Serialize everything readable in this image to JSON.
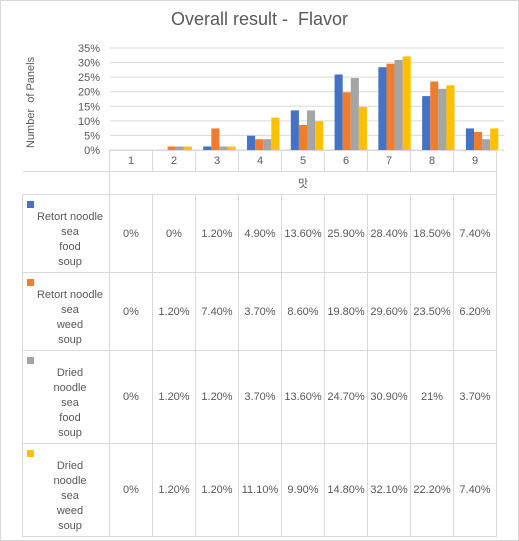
{
  "chart_data": {
    "type": "bar",
    "title": "Overall result -  Flavor",
    "ylabel": "Number  of Panels",
    "xlabel": "맛",
    "categories": [
      "1",
      "2",
      "3",
      "4",
      "5",
      "6",
      "7",
      "8",
      "9"
    ],
    "ylim": [
      0,
      35
    ],
    "yticks": [
      "0%",
      "5%",
      "10%",
      "15%",
      "20%",
      "25%",
      "30%",
      "35%"
    ],
    "ytick_values": [
      0,
      5,
      10,
      15,
      20,
      25,
      30,
      35
    ],
    "grid": true,
    "legend": "data-table",
    "series": [
      {
        "name": "Retort noodle\nsea\nfood\nsoup",
        "color": "#4472c4",
        "values": [
          0,
          0,
          1.2,
          4.9,
          13.6,
          25.9,
          28.4,
          18.5,
          7.4
        ],
        "labels": [
          "0%",
          "0%",
          "1.20%",
          "4.90%",
          "13.60%",
          "25.90%",
          "28.40%",
          "18.50%",
          "7.40%"
        ]
      },
      {
        "name": "Retort noodle\nsea\nweed\nsoup",
        "color": "#ed7d31",
        "values": [
          0,
          1.2,
          7.4,
          3.7,
          8.6,
          19.8,
          29.6,
          23.5,
          6.2
        ],
        "labels": [
          "0%",
          "1.20%",
          "7.40%",
          "3.70%",
          "8.60%",
          "19.80%",
          "29.60%",
          "23.50%",
          "6.20%"
        ]
      },
      {
        "name": "Dried\nnoodle\nsea\nfood\nsoup",
        "color": "#a5a5a5",
        "values": [
          0,
          1.2,
          1.2,
          3.7,
          13.6,
          24.7,
          30.9,
          21,
          3.7
        ],
        "labels": [
          "0%",
          "1.20%",
          "1.20%",
          "3.70%",
          "13.60%",
          "24.70%",
          "30.90%",
          "21%",
          "3.70%"
        ]
      },
      {
        "name": "Dried\nnoodle\nsea\nweed\nsoup",
        "color": "#ffc000",
        "values": [
          0,
          1.2,
          1.2,
          11.1,
          9.9,
          14.8,
          32.1,
          22.2,
          7.4
        ],
        "labels": [
          "0%",
          "1.20%",
          "1.20%",
          "11.10%",
          "9.90%",
          "14.80%",
          "32.10%",
          "22.20%",
          "7.40%"
        ]
      }
    ]
  }
}
